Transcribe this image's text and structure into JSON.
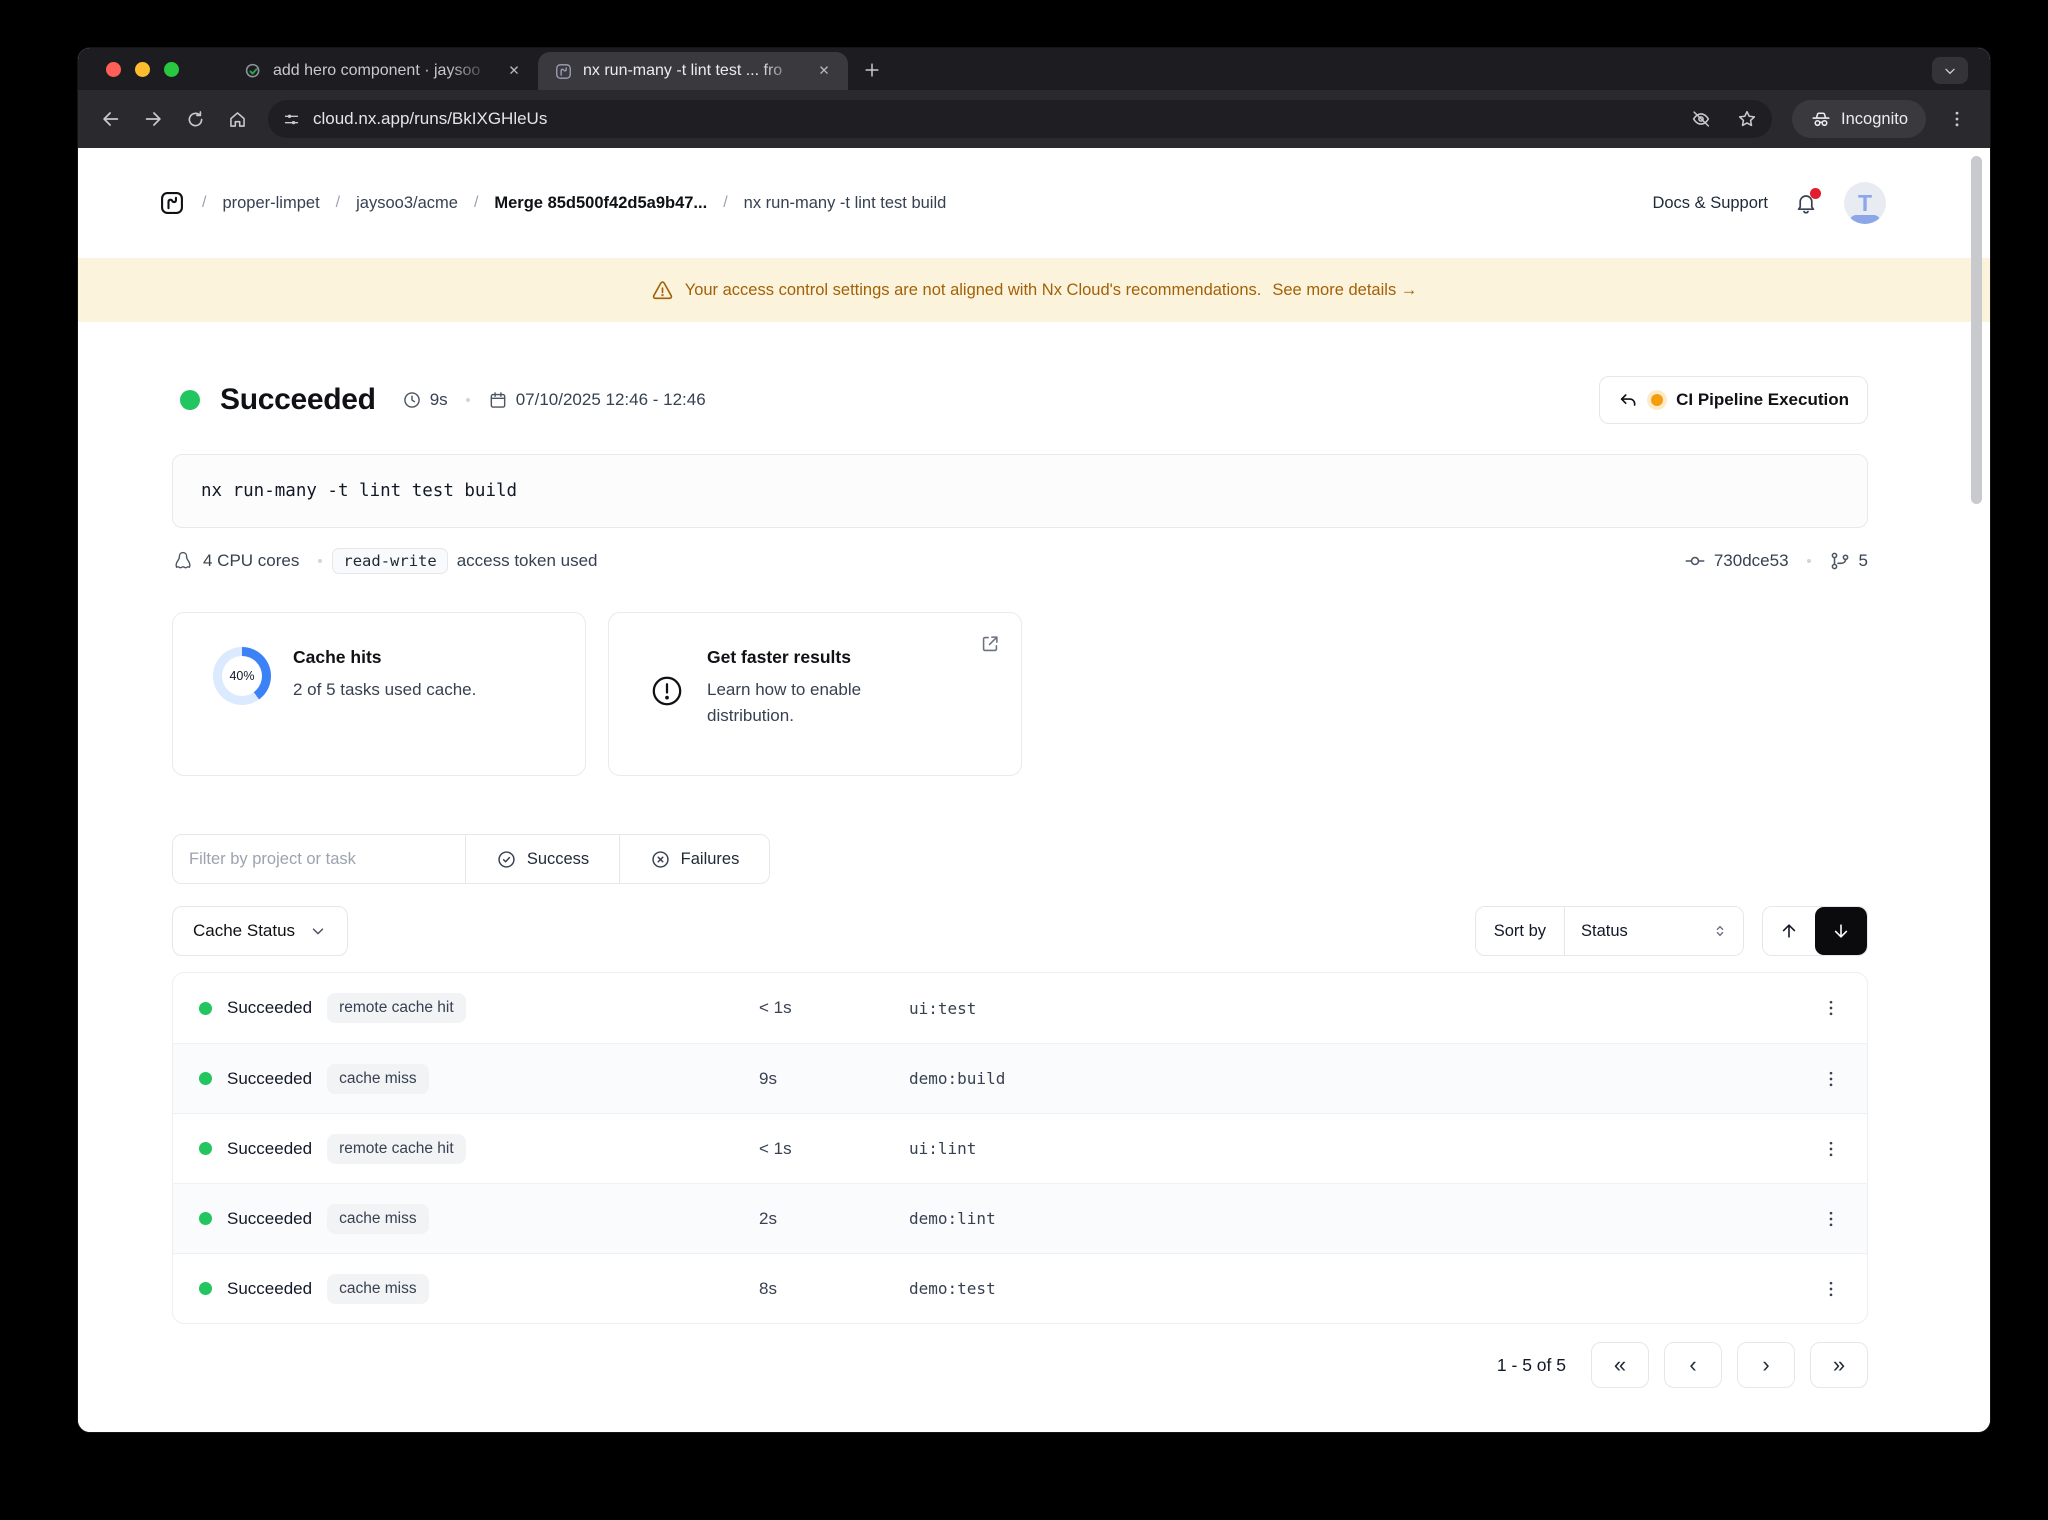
{
  "colors": {
    "success_green": "#22c55e",
    "accent_blue": "#3b82f6",
    "donut_track": "#dbeafe",
    "warning_text": "#a16207",
    "warning_bg": "#fcf3dd"
  },
  "browser": {
    "tabs": [
      {
        "title": "add hero component · jaysoo"
      },
      {
        "title": "nx run-many -t lint test ... fro"
      }
    ],
    "url": "cloud.nx.app/runs/BkIXGHleUs",
    "incognito_label": "Incognito"
  },
  "icons": {
    "close": "✕",
    "plus": "+",
    "separator": "/",
    "first": "«",
    "prev": "‹",
    "next": "›",
    "last": "»"
  },
  "header": {
    "breadcrumbs": [
      "proper-limpet",
      "jaysoo3/acme",
      "Merge 85d500f42d5a9b47...",
      "nx run-many -t lint test build"
    ],
    "docs_label": "Docs & Support",
    "avatar_letter": "T"
  },
  "banner": {
    "text": "Your access control settings are not aligned with Nx Cloud's recommendations.",
    "link": "See more details →"
  },
  "run": {
    "status": "Succeeded",
    "duration": "9s",
    "timestamp": "07/10/2025 12:46 - 12:46",
    "pipeline_button": "CI Pipeline Execution",
    "command": "nx run-many -t lint test build",
    "cpu": "4 CPU cores",
    "token_chip": "read-write",
    "token_suffix": "access token used",
    "commit": "730dce53",
    "branch_count": "5"
  },
  "cards": {
    "cache": {
      "percent": 40,
      "percent_label": "40%",
      "title": "Cache hits",
      "desc": "2 of 5 tasks used cache."
    },
    "distribution": {
      "title": "Get faster results",
      "desc": "Learn how to enable distribution."
    }
  },
  "filters": {
    "placeholder": "Filter by project or task",
    "success": "Success",
    "failures": "Failures"
  },
  "toolbar": {
    "cache_status": "Cache Status",
    "sort_by": "Sort by",
    "sort_value": "Status"
  },
  "table": {
    "rows": [
      {
        "status": "Succeeded",
        "cache": "remote cache hit",
        "duration": "< 1s",
        "task": "ui:test"
      },
      {
        "status": "Succeeded",
        "cache": "cache miss",
        "duration": "9s",
        "task": "demo:build"
      },
      {
        "status": "Succeeded",
        "cache": "remote cache hit",
        "duration": "< 1s",
        "task": "ui:lint"
      },
      {
        "status": "Succeeded",
        "cache": "cache miss",
        "duration": "2s",
        "task": "demo:lint"
      },
      {
        "status": "Succeeded",
        "cache": "cache miss",
        "duration": "8s",
        "task": "demo:test"
      }
    ]
  },
  "pagination": {
    "label": "1 - 5 of 5"
  }
}
